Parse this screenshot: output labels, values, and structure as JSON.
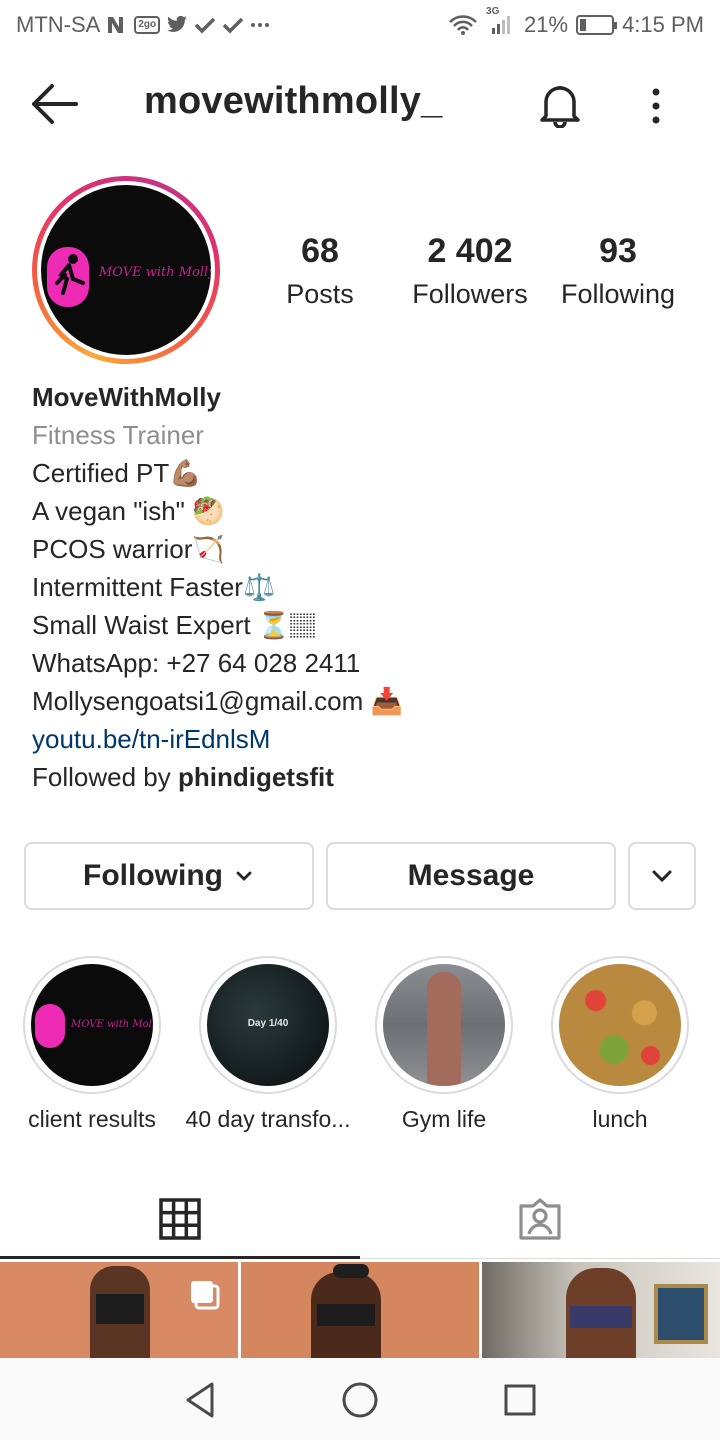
{
  "status_bar": {
    "carrier": "MTN-SA",
    "network": "3G",
    "battery_percent": "21%",
    "battery_level": 0.21,
    "time": "4:15 PM"
  },
  "header": {
    "username": "movewithmolly_"
  },
  "profile": {
    "avatar_text": "MOVE with Molly",
    "stats": [
      {
        "value": "68",
        "label": "Posts"
      },
      {
        "value": "2 402",
        "label": "Followers"
      },
      {
        "value": "93",
        "label": "Following"
      }
    ],
    "bio": {
      "name": "MoveWithMolly",
      "category": "Fitness Trainer",
      "lines": [
        "Certified PT💪🏽",
        "A vegan \"ish\" 🥙",
        "PCOS warrior🏹",
        "Intermittent Faster⚖️",
        "Small Waist Expert ⏳🏽",
        "WhatsApp: +27 64 028 2411",
        "Mollysengoatsi1@gmail.com 📥"
      ],
      "link": "youtu.be/tn-irEdnlsM",
      "followed_by_prefix": "Followed by ",
      "followed_by_user": "phindigetsfit"
    }
  },
  "actions": {
    "following_label": "Following",
    "message_label": "Message"
  },
  "highlights": [
    {
      "label": "client results",
      "image_text": "MOVE with Molly"
    },
    {
      "label": "40 day transfo...",
      "image_text": "Day 1/40"
    },
    {
      "label": "Gym life"
    },
    {
      "label": "lunch"
    }
  ]
}
